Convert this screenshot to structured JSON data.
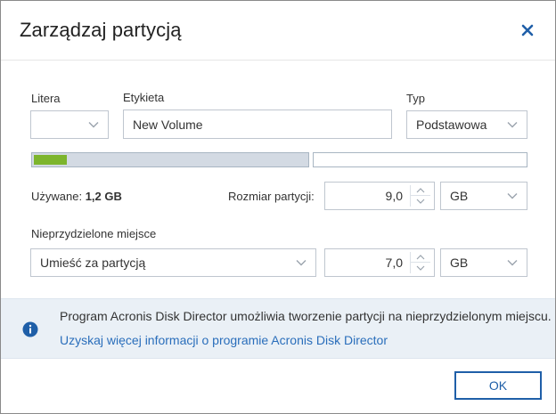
{
  "dialog": {
    "title": "Zarządzaj partycją"
  },
  "fields": {
    "letter_label": "Litera",
    "letter_value": "",
    "label_label": "Etykieta",
    "label_value": "New Volume",
    "type_label": "Typ",
    "type_value": "Podstawowa"
  },
  "usage": {
    "used_fraction": 0.12,
    "used_label": "Używane:",
    "used_value": "1,2 GB",
    "size_label": "Rozmiar partycji:",
    "size_value": "9,0",
    "size_unit": "GB"
  },
  "unallocated": {
    "label": "Nieprzydzielone miejsce",
    "placement_value": "Umieść za partycją",
    "size_value": "7,0",
    "size_unit": "GB"
  },
  "info": {
    "message": "Program Acronis Disk Director umożliwia tworzenie partycji na nieprzydzielonym miejscu.",
    "link": "Uzyskaj więcej informacji o programie Acronis Disk Director",
    "icon": "info-icon"
  },
  "footer": {
    "ok_label": "OK"
  },
  "colors": {
    "accent": "#1f5fa8",
    "link": "#2a6ebb",
    "used_bar": "#7db52d",
    "bar_track": "#d3dae3",
    "info_bg": "#eaf0f6"
  }
}
